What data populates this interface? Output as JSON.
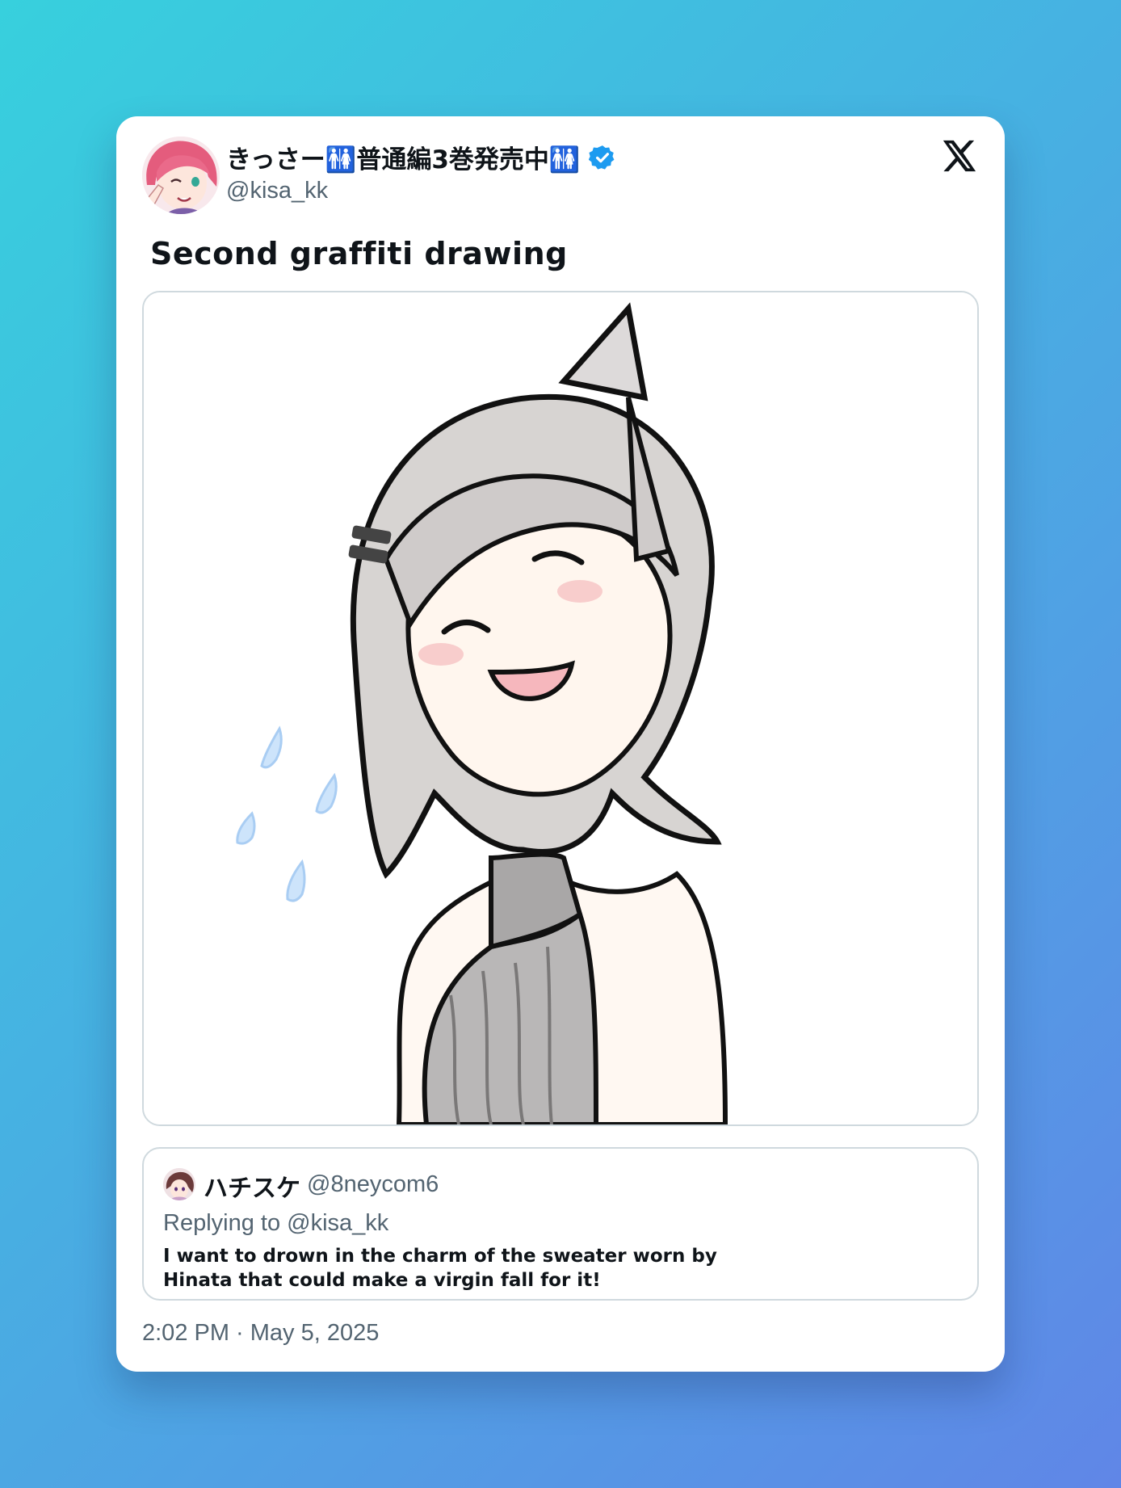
{
  "tweet": {
    "display_name": "きっさー🚻普通編3巻発売中🚻",
    "handle": "@kisa_kk",
    "text": "Second graffiti drawing",
    "timestamp": "2:02 PM · May 5, 2025",
    "verified": true
  },
  "quote": {
    "display_name": "ハチスケ",
    "handle": "@8neycom6",
    "replying_prefix": "Replying to ",
    "replying_to": "@kisa_kk",
    "text": "I want to drown in the charm of the sweater worn by Hinata that could make a virgin fall for it!"
  },
  "icons": {
    "x_logo": "x-logo-icon",
    "verified": "verified-badge-icon"
  },
  "colors": {
    "background_start": "#37d0dd",
    "background_end": "#6086e7",
    "card": "#ffffff",
    "text_primary": "#0f1419",
    "text_secondary": "#536471",
    "verified_blue": "#1d9bf0",
    "border": "#cfd9de"
  }
}
